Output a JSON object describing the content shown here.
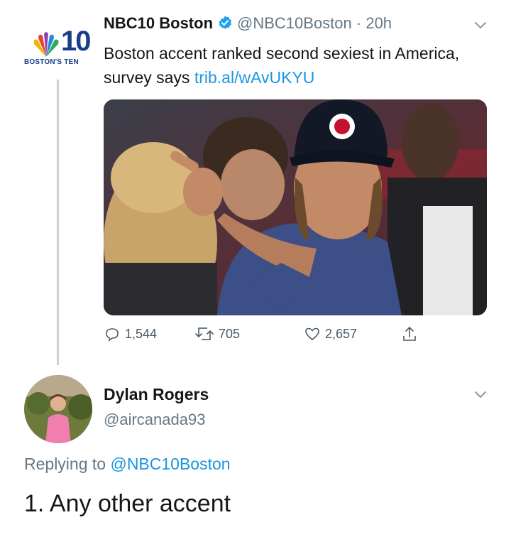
{
  "tweet": {
    "author_name": "NBC10 Boston",
    "verified_icon": "verified-badge-icon",
    "handle": "@NBC10Boston",
    "separator": "·",
    "time": "20h",
    "text": "Boston accent ranked second sexiest in America, survey says ",
    "link": "trib.al/wAvUKYU",
    "logo_number": "10",
    "logo_subtitle": "BOSTON'S TEN",
    "actions": {
      "replies": "1,544",
      "retweets": "705",
      "likes": "2,657"
    }
  },
  "reply": {
    "author_name": "Dylan Rogers",
    "handle": "@aircanada93",
    "replying_prefix": "Replying to ",
    "replying_to": "@NBC10Boston",
    "text": "1. Any other accent"
  },
  "colors": {
    "link": "#1b95e0",
    "secondary_text": "#657786",
    "verified": "#1da1f2"
  }
}
